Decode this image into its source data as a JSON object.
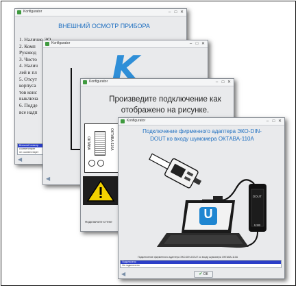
{
  "windows": {
    "w1": {
      "title": "Konfigurator",
      "heading": "ВНЕШНИЙ ОСМОТР ПРИБОРА",
      "items": [
        "1. Наличие ЭО",
        "2. Комп",
        "Руковод",
        "3. Чисто",
        "4. Налич",
        "лей и пл",
        "5. Отсут",
        "корпуса",
        "тов конс",
        "выключа",
        "6. Подде",
        "все надп"
      ],
      "status": [
        "Внешний осмотр",
        "соответствует",
        "не соответствует"
      ]
    },
    "w2": {
      "title": "Konfigurator",
      "logo": "K"
    },
    "w3": {
      "title": "Konfigurator",
      "instruction": "Произведите подключение как отображено на рисунке.",
      "device_labels": [
        "ОКТАВА",
        "ОКТАВА-110А"
      ],
      "footer": "Подключите к Гене"
    },
    "w4": {
      "title": "Konfigurator",
      "heading": "Подключение фирменного адаптера ЭКО-DIN-DOUT ко входу шумомера ОКТАВА-110А",
      "usb_labels": [
        "DOUT",
        "USB"
      ],
      "logo": "U",
      "caption": "Подключение фирменного адаптера ЭКО-DIN-DOUT ко входу шумомера ОКТАВА-110А",
      "list": [
        "Подключено",
        "Не подключено"
      ],
      "ok_label": "ОК"
    }
  },
  "colors": {
    "accent": "#1e6fc0",
    "selection": "#2b3ec8",
    "window_bg": "#e9eaec"
  }
}
